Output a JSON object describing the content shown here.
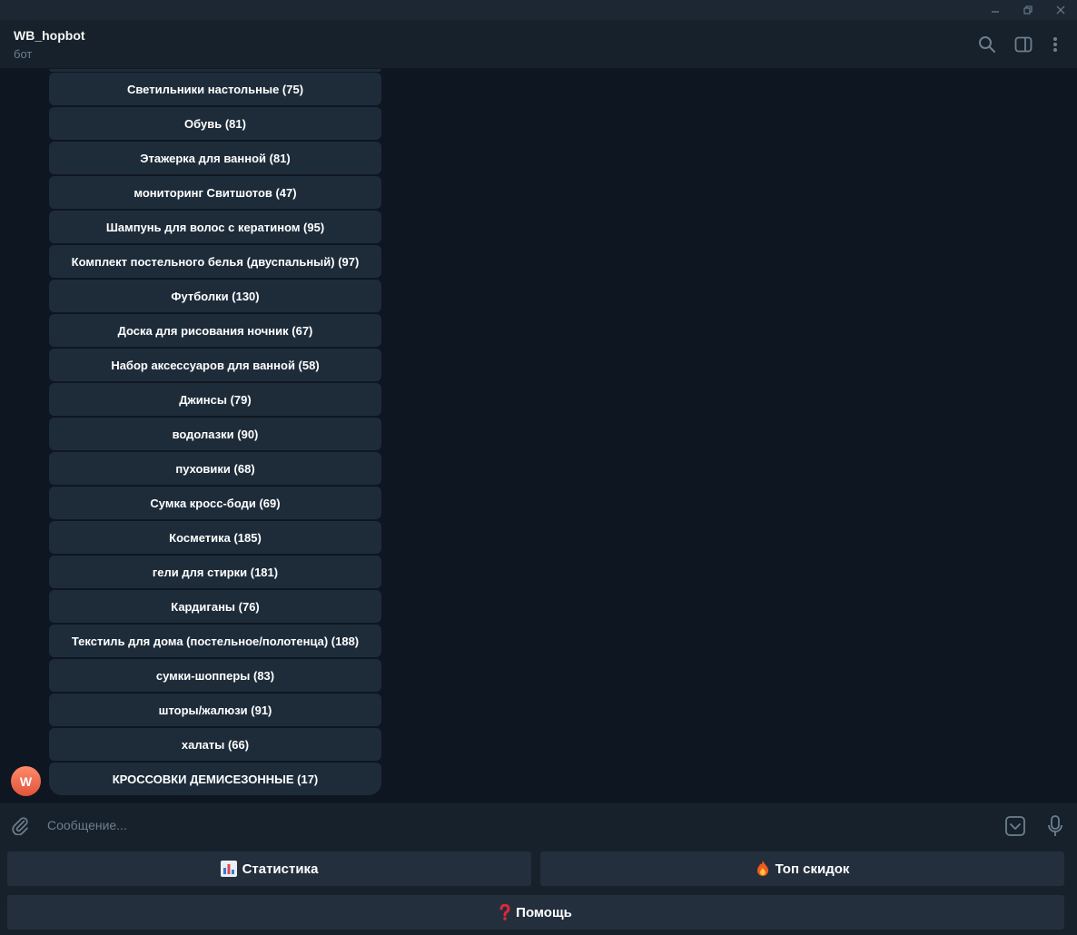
{
  "window": {
    "controls": [
      "minimize-icon",
      "restore-icon",
      "close-icon"
    ]
  },
  "header": {
    "title": "WB_hopbot",
    "subtitle": "бот",
    "icons": [
      "search-icon",
      "sidebar-toggle-icon",
      "more-vertical-icon"
    ]
  },
  "bot": {
    "avatar_letter": "W",
    "avatar_color": "#e8604a"
  },
  "keyboard": {
    "buttons": [
      "Светильники настольные (75)",
      "Обувь (81)",
      "Этажерка для ванной (81)",
      "мониторинг Свитшотов (47)",
      "Шампунь для волос с кератином (95)",
      "Комплект постельного белья (двуспальный) (97)",
      "Футболки (130)",
      "Доска для рисования ночник (67)",
      "Набор аксессуаров для ванной (58)",
      "Джинсы (79)",
      "водолазки (90)",
      "пуховики (68)",
      "Сумка кросс-боди (69)",
      "Косметика (185)",
      "гели для стирки (181)",
      "Кардиганы (76)",
      "Текстиль для дома (постельное/полотенца) (188)",
      "сумки-шопперы (83)",
      "шторы/жалюзи (91)",
      "халаты (66)",
      "КРОССОВКИ ДЕМИСЕЗОННЫЕ (17)"
    ]
  },
  "composer": {
    "placeholder": "Сообщение..."
  },
  "reply_keyboard": {
    "statistics": "Статистика",
    "top_discounts": "Топ скидок",
    "help": "Помощь"
  },
  "colors": {
    "background": "#0e1621",
    "header": "#17212b",
    "button": "#1e2c3a",
    "accent_icon": "#6d7f8f"
  }
}
